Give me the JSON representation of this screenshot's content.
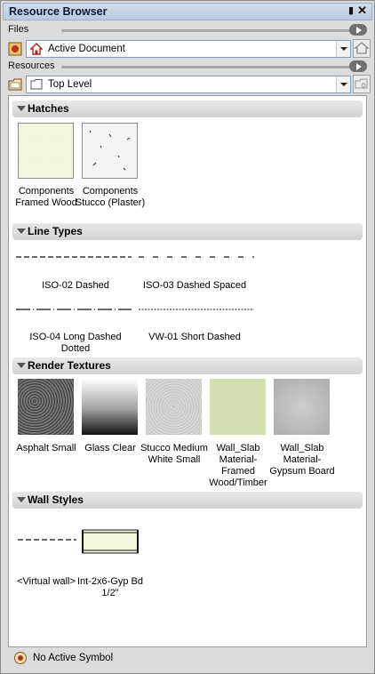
{
  "window": {
    "title": "Resource Browser"
  },
  "files": {
    "label": "Files",
    "document": "Active Document"
  },
  "resources": {
    "label": "Resources",
    "folder": "Top Level"
  },
  "categories": {
    "hatches": {
      "title": "Hatches",
      "items": [
        "Components Framed Wood",
        "Components Stucco (Plaster)"
      ]
    },
    "line_types": {
      "title": "Line Types",
      "items": [
        "ISO-02 Dashed",
        "ISO-03 Dashed Spaced",
        "ISO-04 Long Dashed Dotted",
        "VW-01 Short Dashed"
      ]
    },
    "render_textures": {
      "title": "Render Textures",
      "items": [
        "Asphalt Small",
        "Glass Clear",
        "Stucco Medium White Small",
        "Wall_Slab Material-Framed Wood/Timber",
        "Wall_Slab Material-Gypsum Board"
      ]
    },
    "wall_styles": {
      "title": "Wall Styles",
      "items": [
        "<Virtual wall>",
        "Int-2x6-Gyp Bd 1/2\""
      ]
    }
  },
  "status": {
    "text": "No Active Symbol"
  },
  "colors": {
    "titlebar": "#c4d4e8",
    "accent_green": "#f0f5dc",
    "header": "#d8d8d8"
  }
}
